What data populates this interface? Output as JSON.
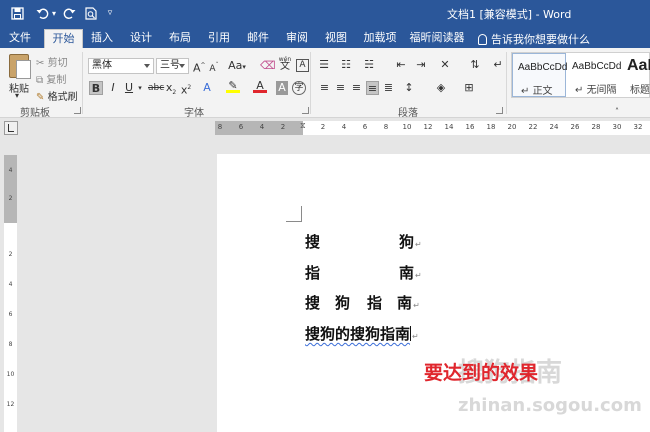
{
  "title_bar": {
    "doc_title": "文档1 [兼容模式] - Word",
    "save_icon": "save-icon",
    "undo_icon": "undo-icon",
    "redo_icon": "redo-icon",
    "print_preview_icon": "print-preview-icon",
    "customize_icon": "customize-quick-access-icon"
  },
  "tabs": [
    {
      "label": "文件",
      "active": false
    },
    {
      "label": "开始",
      "active": true
    },
    {
      "label": "插入",
      "active": false
    },
    {
      "label": "设计",
      "active": false
    },
    {
      "label": "布局",
      "active": false
    },
    {
      "label": "引用",
      "active": false
    },
    {
      "label": "邮件",
      "active": false
    },
    {
      "label": "审阅",
      "active": false
    },
    {
      "label": "视图",
      "active": false
    },
    {
      "label": "加载项",
      "active": false
    },
    {
      "label": "福昕阅读器",
      "active": false
    }
  ],
  "tell_me": "告诉我你想要做什么",
  "clipboard": {
    "paste": "粘贴",
    "cut": "剪切",
    "copy": "复制",
    "format_painter": "格式刷",
    "group_label": "剪贴板"
  },
  "font": {
    "font_name": "黑体",
    "font_size": "三号",
    "change_case": "Aa",
    "phonetic_top": "wén",
    "phonetic_glyph": "文",
    "group_label": "字体",
    "highlight_color": "#ffff00",
    "font_color": "#e0262d"
  },
  "paragraph": {
    "group_label": "段落"
  },
  "styles": [
    {
      "preview": "AaBbCcDd",
      "name": "正文"
    },
    {
      "preview": "AaBbCcDd",
      "name": "无间隔"
    },
    {
      "preview": "AaB",
      "name": "标题"
    }
  ],
  "ruler": {
    "left_ticks": [
      "8",
      "6",
      "4",
      "2"
    ],
    "right_ticks": [
      "2",
      "4",
      "6",
      "8",
      "10",
      "12",
      "14",
      "16",
      "18",
      "20",
      "22",
      "24",
      "26",
      "28",
      "30",
      "32"
    ],
    "v_ticks": [
      "4",
      "2",
      "2",
      "4",
      "6",
      "8",
      "10",
      "12"
    ]
  },
  "document": {
    "lines": [
      [
        "搜",
        "狗"
      ],
      [
        "指",
        "南"
      ],
      [
        "搜",
        "狗",
        "指",
        "南"
      ],
      [
        "搜狗的搜狗指南"
      ]
    ],
    "paragraph_mark": "↵",
    "caption": "要达到的效果"
  },
  "watermark": {
    "text": "搜狗指南",
    "url": "zhinan.sogou.com"
  }
}
